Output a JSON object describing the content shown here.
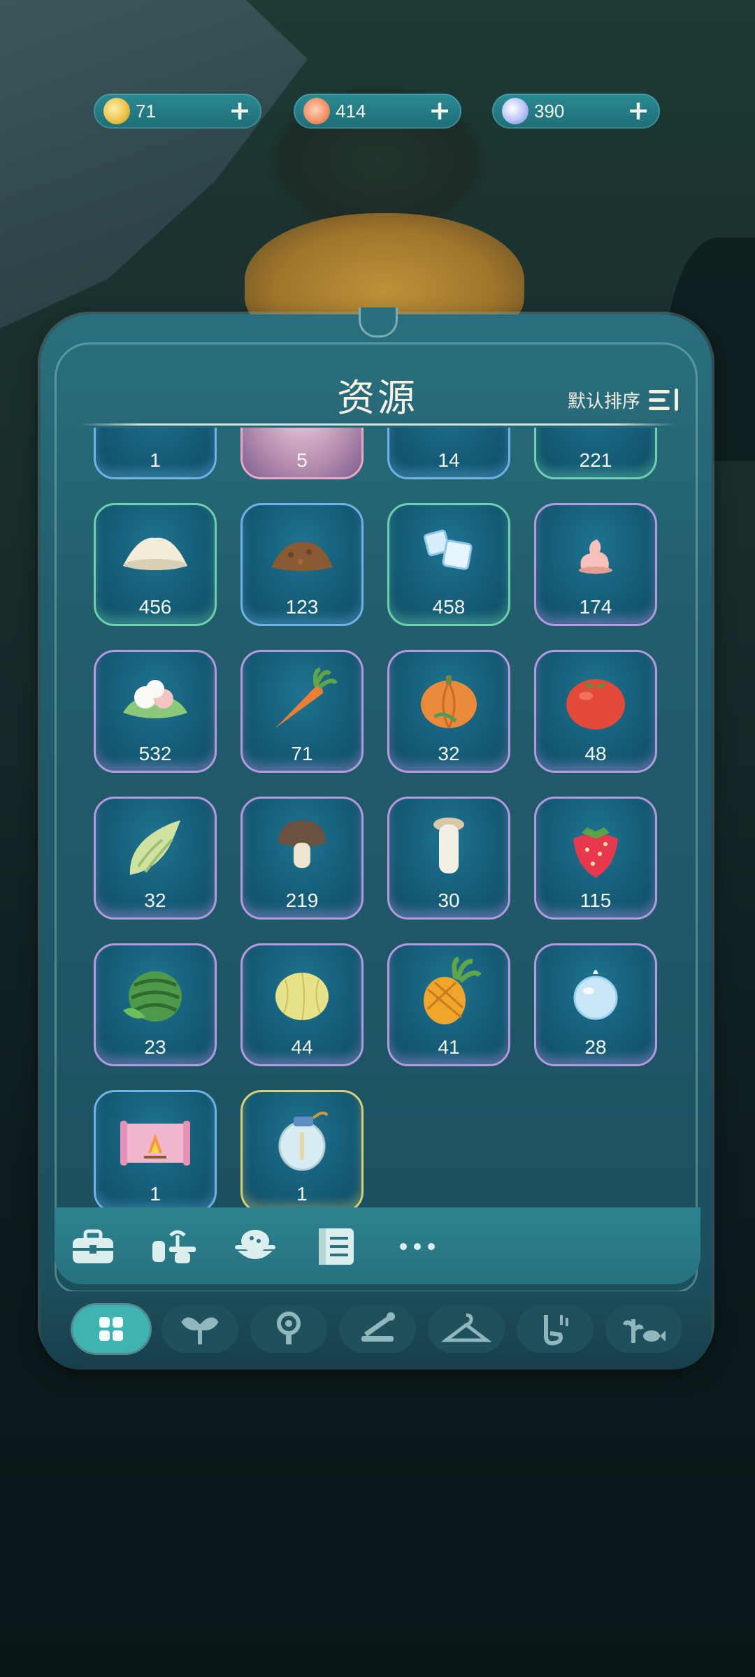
{
  "currencies": [
    {
      "name": "coin-icon",
      "value": "71",
      "color": "#f1cc5a"
    },
    {
      "name": "sun-icon",
      "value": "414",
      "color": "#f19a72"
    },
    {
      "name": "moon-icon",
      "value": "390",
      "color": "#a8b7f2"
    }
  ],
  "panel": {
    "title": "资源",
    "sort_label": "默认排序"
  },
  "items": [
    {
      "icon": "partial-item-icon",
      "qty": "1",
      "rarity": "blue"
    },
    {
      "icon": "partial-item-icon",
      "qty": "5",
      "rarity": "pink"
    },
    {
      "icon": "partial-item-icon",
      "qty": "14",
      "rarity": "blue"
    },
    {
      "icon": "partial-item-icon",
      "qty": "221",
      "rarity": "green"
    },
    {
      "icon": "flour-icon",
      "qty": "456",
      "rarity": "green"
    },
    {
      "icon": "soil-icon",
      "qty": "123",
      "rarity": "blue"
    },
    {
      "icon": "ice-cubes-icon",
      "qty": "458",
      "rarity": "green"
    },
    {
      "icon": "cream-icon",
      "qty": "174",
      "rarity": "purple"
    },
    {
      "icon": "dumpling-icon",
      "qty": "532",
      "rarity": "purple"
    },
    {
      "icon": "carrot-icon",
      "qty": "71",
      "rarity": "purple"
    },
    {
      "icon": "pumpkin-icon",
      "qty": "32",
      "rarity": "purple"
    },
    {
      "icon": "tomato-icon",
      "qty": "48",
      "rarity": "purple"
    },
    {
      "icon": "bamboo-shoot-icon",
      "qty": "32",
      "rarity": "purple"
    },
    {
      "icon": "mushroom-icon",
      "qty": "219",
      "rarity": "purple"
    },
    {
      "icon": "king-oyster-mushroom-icon",
      "qty": "30",
      "rarity": "purple"
    },
    {
      "icon": "strawberry-icon",
      "qty": "115",
      "rarity": "purple"
    },
    {
      "icon": "watermelon-icon",
      "qty": "23",
      "rarity": "purple"
    },
    {
      "icon": "melon-icon",
      "qty": "44",
      "rarity": "purple"
    },
    {
      "icon": "pineapple-icon",
      "qty": "41",
      "rarity": "purple"
    },
    {
      "icon": "water-drop-icon",
      "qty": "28",
      "rarity": "purple"
    },
    {
      "icon": "campfire-scroll-icon",
      "qty": "1",
      "rarity": "blue"
    },
    {
      "icon": "potion-bottle-icon",
      "qty": "1",
      "rarity": "gold"
    }
  ],
  "subtabs": [
    "toolbox-icon",
    "sprout-pot-icon",
    "food-bowl-icon",
    "recipe-book-icon",
    "more-icon"
  ],
  "tabs": [
    "grid-icon",
    "plant-icon",
    "flower-pot-icon",
    "tools-icon",
    "hanger-icon",
    "music-icon",
    "fish-plant-icon"
  ],
  "colors": {
    "accent": "#3fb2b2",
    "panel": "#225d6b",
    "text": "#f7f2e3"
  }
}
